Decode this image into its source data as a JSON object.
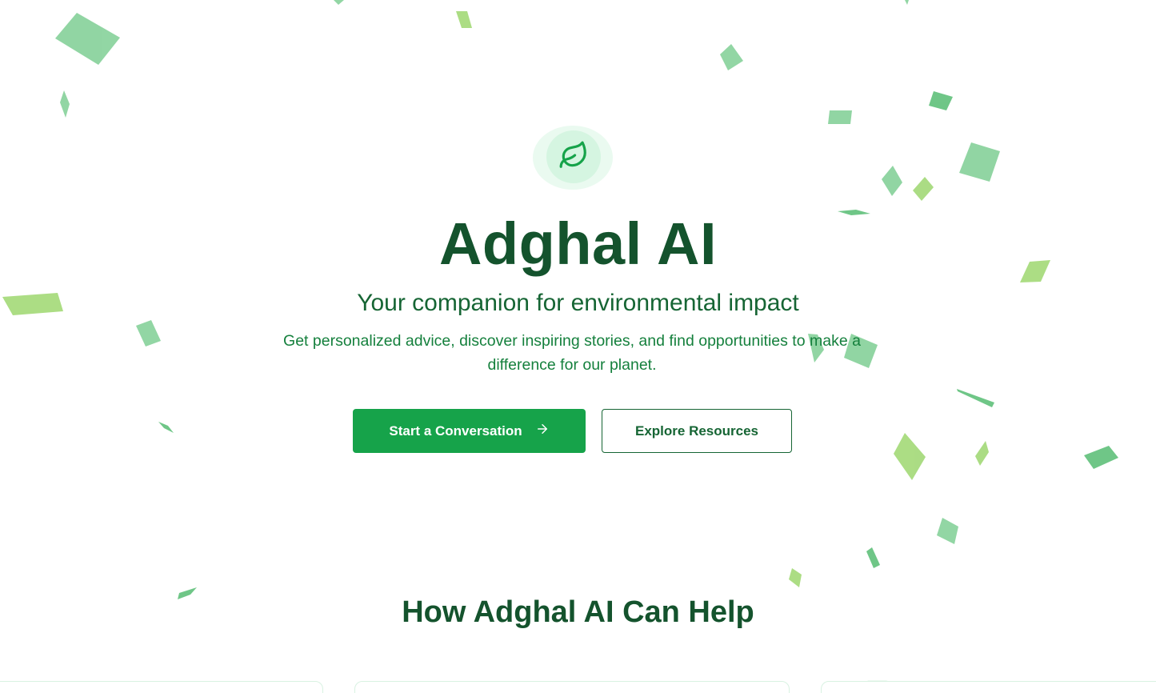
{
  "hero": {
    "logo_icon": "leaf-icon",
    "title": "Adghal AI",
    "subtitle": "Your companion for environmental impact",
    "description": "Get personalized advice, discover inspiring stories, and find opportunities to make a difference for our planet.",
    "primary_button": {
      "label": "Start a Conversation",
      "icon": "arrow-right-icon"
    },
    "secondary_button": {
      "label": "Explore Resources"
    }
  },
  "features": {
    "title": "How Adghal AI Can Help"
  },
  "colors": {
    "brand_dark": "#14532d",
    "brand": "#16a34a",
    "text_green": "#15803d",
    "confetti_green": "#86d19a",
    "confetti_lime": "#a3d977"
  }
}
